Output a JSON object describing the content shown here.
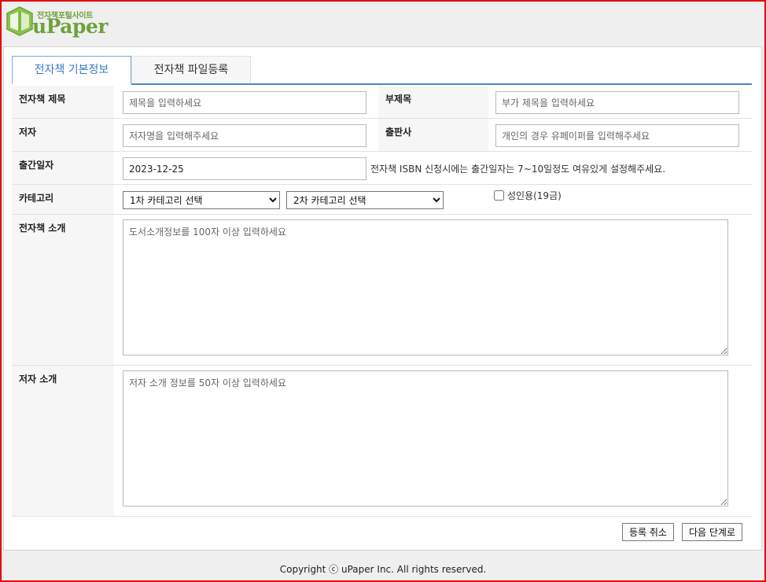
{
  "header": {
    "logo_kr": "전자책포털사이트",
    "logo_en": "uPaper"
  },
  "tabs": [
    {
      "label": "전자책 기본정보",
      "active": true
    },
    {
      "label": "전자책 파일등록",
      "active": false
    }
  ],
  "form": {
    "title": {
      "label": "전자책 제목",
      "placeholder": "제목을 입력하세요",
      "value": ""
    },
    "subtitle": {
      "label": "부제목",
      "placeholder": "부가 제목을 입력하세요",
      "value": ""
    },
    "author": {
      "label": "저자",
      "placeholder": "저자명을 입력해주세요",
      "value": ""
    },
    "publisher": {
      "label": "출판사",
      "placeholder": "개인의 경우 유페이퍼를 입력해주세요",
      "value": ""
    },
    "pub_date": {
      "label": "출간일자",
      "value": "2023-12-25",
      "hint": "전자책 ISBN 신청시에는 출간일자는 7~10일정도 여유있게 설정해주세요."
    },
    "category": {
      "label": "카테고리",
      "primary": "1차 카테고리 선택",
      "secondary": "2차 카테고리 선택",
      "adult_label": "성인용(19금)",
      "adult_checked": false
    },
    "book_intro": {
      "label": "전자책 소개",
      "placeholder": "도서소개정보를 100자 이상 입력하세요",
      "value": ""
    },
    "author_intro": {
      "label": "저자 소개",
      "placeholder": "저자 소개 정보를 50자 이상 입력하세요",
      "value": ""
    }
  },
  "actions": {
    "cancel_label": "등록 취소",
    "next_label": "다음 단계로"
  },
  "footer": {
    "copyright": "Copyright ⓒ uPaper Inc. All rights reserved."
  },
  "colors": {
    "accent": "#3a7bc8",
    "brand": "#6ea23a",
    "frame": "#e8000b"
  }
}
